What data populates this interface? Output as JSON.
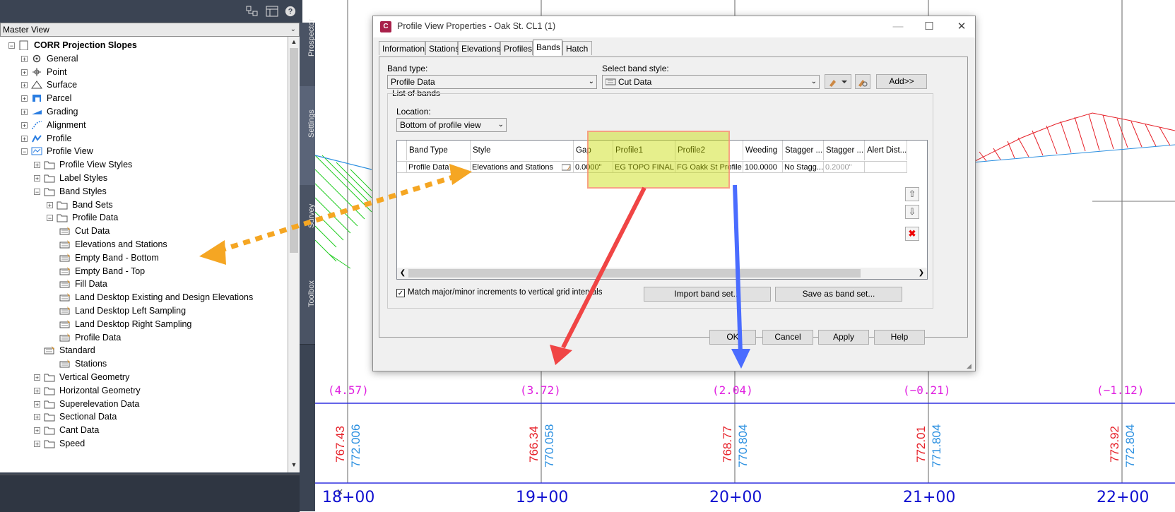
{
  "toolspace": {
    "view_select": "Master View",
    "tabs": [
      "Prospector",
      "Settings",
      "Survey",
      "Toolbox"
    ],
    "tree": [
      {
        "label": "CORR Projection Slopes",
        "bold": true
      },
      {
        "label": "General"
      },
      {
        "label": "Point"
      },
      {
        "label": "Surface"
      },
      {
        "label": "Parcel"
      },
      {
        "label": "Grading"
      },
      {
        "label": "Alignment"
      },
      {
        "label": "Profile"
      },
      {
        "label": "Profile View"
      },
      {
        "label": "Profile View Styles"
      },
      {
        "label": "Label Styles"
      },
      {
        "label": "Band Styles"
      },
      {
        "label": "Band Sets"
      },
      {
        "label": "Profile Data"
      },
      {
        "label": "Cut Data"
      },
      {
        "label": "Elevations and Stations"
      },
      {
        "label": "Empty Band - Bottom"
      },
      {
        "label": "Empty Band - Top"
      },
      {
        "label": "Fill Data"
      },
      {
        "label": "Land Desktop Existing and Design Elevations"
      },
      {
        "label": "Land Desktop Left Sampling"
      },
      {
        "label": "Land Desktop Right Sampling"
      },
      {
        "label": "Profile Data"
      },
      {
        "label": "Standard"
      },
      {
        "label": "Stations"
      },
      {
        "label": "Vertical Geometry"
      },
      {
        "label": "Horizontal Geometry"
      },
      {
        "label": "Superelevation Data"
      },
      {
        "label": "Sectional Data"
      },
      {
        "label": "Cant Data"
      },
      {
        "label": "Speed"
      }
    ]
  },
  "dialog": {
    "title": "Profile View Properties - Oak St. CL1 (1)",
    "tabs": [
      "Information",
      "Stations",
      "Elevations",
      "Profiles",
      "Bands",
      "Hatch"
    ],
    "active_tab": "Bands",
    "band_type_label": "Band type:",
    "band_type_value": "Profile Data",
    "band_style_label": "Select band style:",
    "band_style_value": "Cut Data",
    "add_button": "Add>>",
    "list_of_bands": "List of bands",
    "location_label": "Location:",
    "location_value": "Bottom of profile view",
    "columns": [
      "Band Type",
      "Style",
      "Gap",
      "Profile1",
      "Profile2",
      "Weeding",
      "Stagger ...",
      "Stagger ...",
      "Alert Dist..."
    ],
    "row": [
      "Profile Data",
      "Elevations and Stations",
      "0.0000\"",
      "EG TOPO FINAL",
      "FG Oakk St Profile",
      "100.0000",
      "No Stagg...",
      "0.2000\"",
      ""
    ],
    "match_checkbox": "Match major/minor increments to vertical grid intervals",
    "import_button": "Import band set...",
    "save_button": "Save as band set...",
    "ok": "OK",
    "cancel": "Cancel",
    "apply": "Apply",
    "help": "Help"
  },
  "drawing": {
    "cut_values": [
      "(4.57)",
      "(3.72)",
      "(2.04)",
      "(−0.21)",
      "(−1.12)"
    ],
    "eg_elevations": [
      "767.43",
      "766.34",
      "768.77",
      "772.01",
      "773.92"
    ],
    "fg_elevations": [
      "772.006",
      "770.058",
      "770.804",
      "771.804",
      "772.804"
    ],
    "stations": [
      "18+00",
      "19+00",
      "20+00",
      "21+00",
      "22+00"
    ],
    "colors": {
      "eg": "#e62129",
      "fg": "#2a8fe0",
      "cut": "#e020e0",
      "station": "#1010d0",
      "band_line": "#3030e0"
    }
  }
}
